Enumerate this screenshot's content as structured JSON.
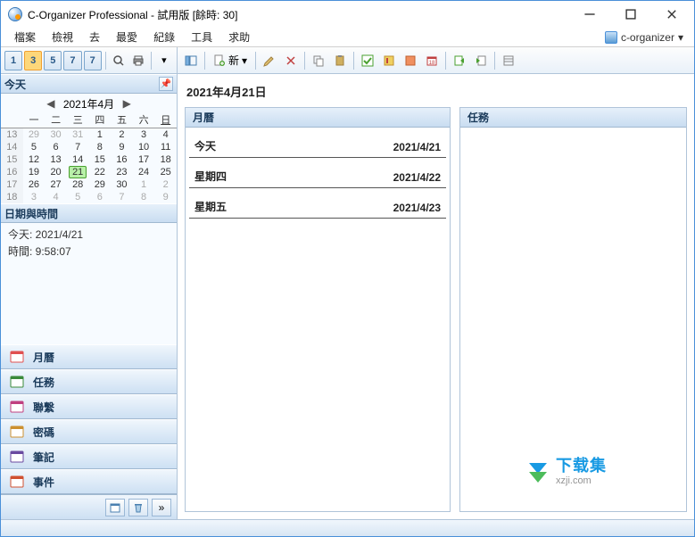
{
  "title": "C-Organizer Professional - 試用版  [餘時: 30]",
  "menu": [
    "檔案",
    "檢視",
    "去",
    "最愛",
    "紀錄",
    "工具",
    "求助"
  ],
  "dbname": "c-organizer",
  "leftToolbar": {
    "viewBtns": [
      "1",
      "3",
      "5",
      "7",
      "7"
    ]
  },
  "newLabel": "新",
  "sidebar": {
    "todayTitle": "今天",
    "calTitle": "2021年4月",
    "weekHdr": [
      "一",
      "二",
      "三",
      "四",
      "五",
      "六",
      "日"
    ],
    "weeks": [
      {
        "wk": "13",
        "days": [
          {
            "d": "29",
            "dim": 1
          },
          {
            "d": "30",
            "dim": 1
          },
          {
            "d": "31",
            "dim": 1
          },
          {
            "d": "1"
          },
          {
            "d": "2"
          },
          {
            "d": "3"
          },
          {
            "d": "4"
          }
        ]
      },
      {
        "wk": "14",
        "days": [
          {
            "d": "5"
          },
          {
            "d": "6"
          },
          {
            "d": "7"
          },
          {
            "d": "8"
          },
          {
            "d": "9"
          },
          {
            "d": "10"
          },
          {
            "d": "11"
          }
        ]
      },
      {
        "wk": "15",
        "days": [
          {
            "d": "12"
          },
          {
            "d": "13"
          },
          {
            "d": "14"
          },
          {
            "d": "15"
          },
          {
            "d": "16"
          },
          {
            "d": "17"
          },
          {
            "d": "18"
          }
        ]
      },
      {
        "wk": "16",
        "days": [
          {
            "d": "19"
          },
          {
            "d": "20"
          },
          {
            "d": "21",
            "today": 1
          },
          {
            "d": "22"
          },
          {
            "d": "23"
          },
          {
            "d": "24"
          },
          {
            "d": "25"
          }
        ]
      },
      {
        "wk": "17",
        "days": [
          {
            "d": "26"
          },
          {
            "d": "27"
          },
          {
            "d": "28"
          },
          {
            "d": "29"
          },
          {
            "d": "30"
          },
          {
            "d": "1",
            "dim": 1
          },
          {
            "d": "2",
            "dim": 1
          }
        ]
      },
      {
        "wk": "18",
        "days": [
          {
            "d": "3",
            "dim": 1
          },
          {
            "d": "4",
            "dim": 1
          },
          {
            "d": "5",
            "dim": 1
          },
          {
            "d": "6",
            "dim": 1
          },
          {
            "d": "7",
            "dim": 1
          },
          {
            "d": "8",
            "dim": 1
          },
          {
            "d": "9",
            "dim": 1
          }
        ]
      }
    ],
    "dtTitle": "日期與時間",
    "todayLine": "今天: 2021/4/21",
    "timeLine": "時間: 9:58:07",
    "nav": [
      {
        "label": "月曆",
        "color": "#e05050"
      },
      {
        "label": "任務",
        "color": "#3a8a3a"
      },
      {
        "label": "聯繫",
        "color": "#c04080"
      },
      {
        "label": "密碼",
        "color": "#cc9030"
      },
      {
        "label": "筆記",
        "color": "#6a4aa0"
      },
      {
        "label": "事件",
        "color": "#d05030"
      }
    ]
  },
  "main": {
    "dateHeader": "2021年4月21日",
    "monthPanel": "月曆",
    "taskPanel": "任務",
    "rows": [
      {
        "label": "今天",
        "date": "2021/4/21"
      },
      {
        "label": "星期四",
        "date": "2021/4/22"
      },
      {
        "label": "星期五",
        "date": "2021/4/23"
      }
    ]
  },
  "watermark": {
    "l1": "下载集",
    "l2": "xzji.com"
  }
}
